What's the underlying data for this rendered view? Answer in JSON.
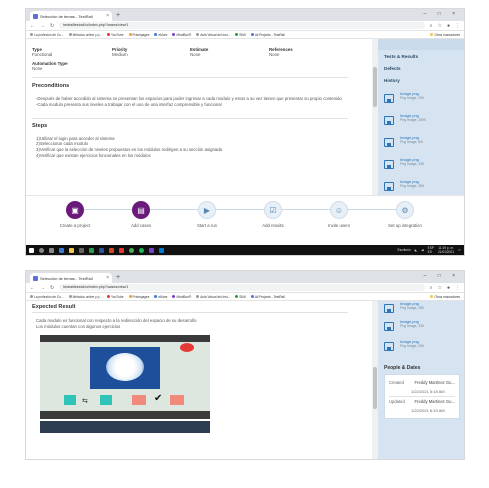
{
  "browser": {
    "tab_title": "Selección de temas - TestRail",
    "url": "testrailtestrail.io/index.php?/cases/view/1",
    "bookmarks": [
      "La profesión de Co...",
      "Métodos online y p...",
      "YouTube",
      "Prismpages",
      "eMore",
      "MindBox®",
      "Aula Virtual del Inst...",
      "SIMI",
      "All Projects - TestRail",
      "Otros marcadores"
    ]
  },
  "case": {
    "fields": [
      {
        "label": "Type",
        "value": "Functional"
      },
      {
        "label": "Priority",
        "value": "Medium"
      },
      {
        "label": "Estimate",
        "value": "None"
      },
      {
        "label": "References",
        "value": "None"
      }
    ],
    "automation_label": "Automation Type",
    "automation_value": "None",
    "preconditions_title": "Preconditions",
    "preconditions": [
      "-Después de haber accedido al sistema se presentan los espacios para poder ingresar a cada modulo y estos a su vez tienen que presentar su propio contenido",
      "-Cada modulo presenta sus niveles a trabajar con el uso de una interfaz comprensible y funcional"
    ],
    "steps_title": "Steps",
    "steps": [
      "1)Utilizar el login para acceder al sistema",
      "2)Seleccionar cada modulo",
      "3)Verificar que la selección de niveles propuestos en los módulos redirigen a su sección asignada",
      "4)Verificar que existan ejercicios funcionales en los módulos"
    ],
    "expected_title": "Expected Result",
    "expected": [
      "Cada modulo es funcional con respecto a la redirección del espacio de su desarrollo",
      "Los módulos cuentan con algunos ejercicios"
    ]
  },
  "sidebar": {
    "links": [
      "Tests & Results",
      "Defects",
      "History"
    ],
    "attachments_top": [
      {
        "name": "Image.png",
        "size": "Png Image, 29K"
      },
      {
        "name": "Image.png",
        "size": "Png Image, 289K"
      },
      {
        "name": "Image.png",
        "size": "Png Image, 8iK"
      },
      {
        "name": "Image.png",
        "size": "Png Image, 33K"
      },
      {
        "name": "Image.png",
        "size": "Png Image, 38K"
      }
    ],
    "attachments_bottom": [
      {
        "name": "Image.png",
        "size": "Png Image, 28K"
      },
      {
        "name": "Image.png",
        "size": "Png Image, 33K"
      },
      {
        "name": "Image.png",
        "size": "Png Image, 26K"
      }
    ],
    "people_title": "People & Dates",
    "created_label": "Created",
    "created_user": "Freddy Martinez Gu...",
    "created_date": "1/22/2021 5:18 AM",
    "updated_label": "Updated",
    "updated_user": "Freddy Martinez Gu...",
    "updated_date": "1/22/2021 6:19 AM"
  },
  "progress": {
    "steps": [
      "Create a project",
      "Add cases",
      "Start a run",
      "Add results",
      "Invite users",
      "Set up integration"
    ]
  },
  "taskbar": {
    "status": "Escritorio",
    "lang": "ESP",
    "region": "ES",
    "time": "11:19 p. m.",
    "date": "21/01/2021"
  }
}
